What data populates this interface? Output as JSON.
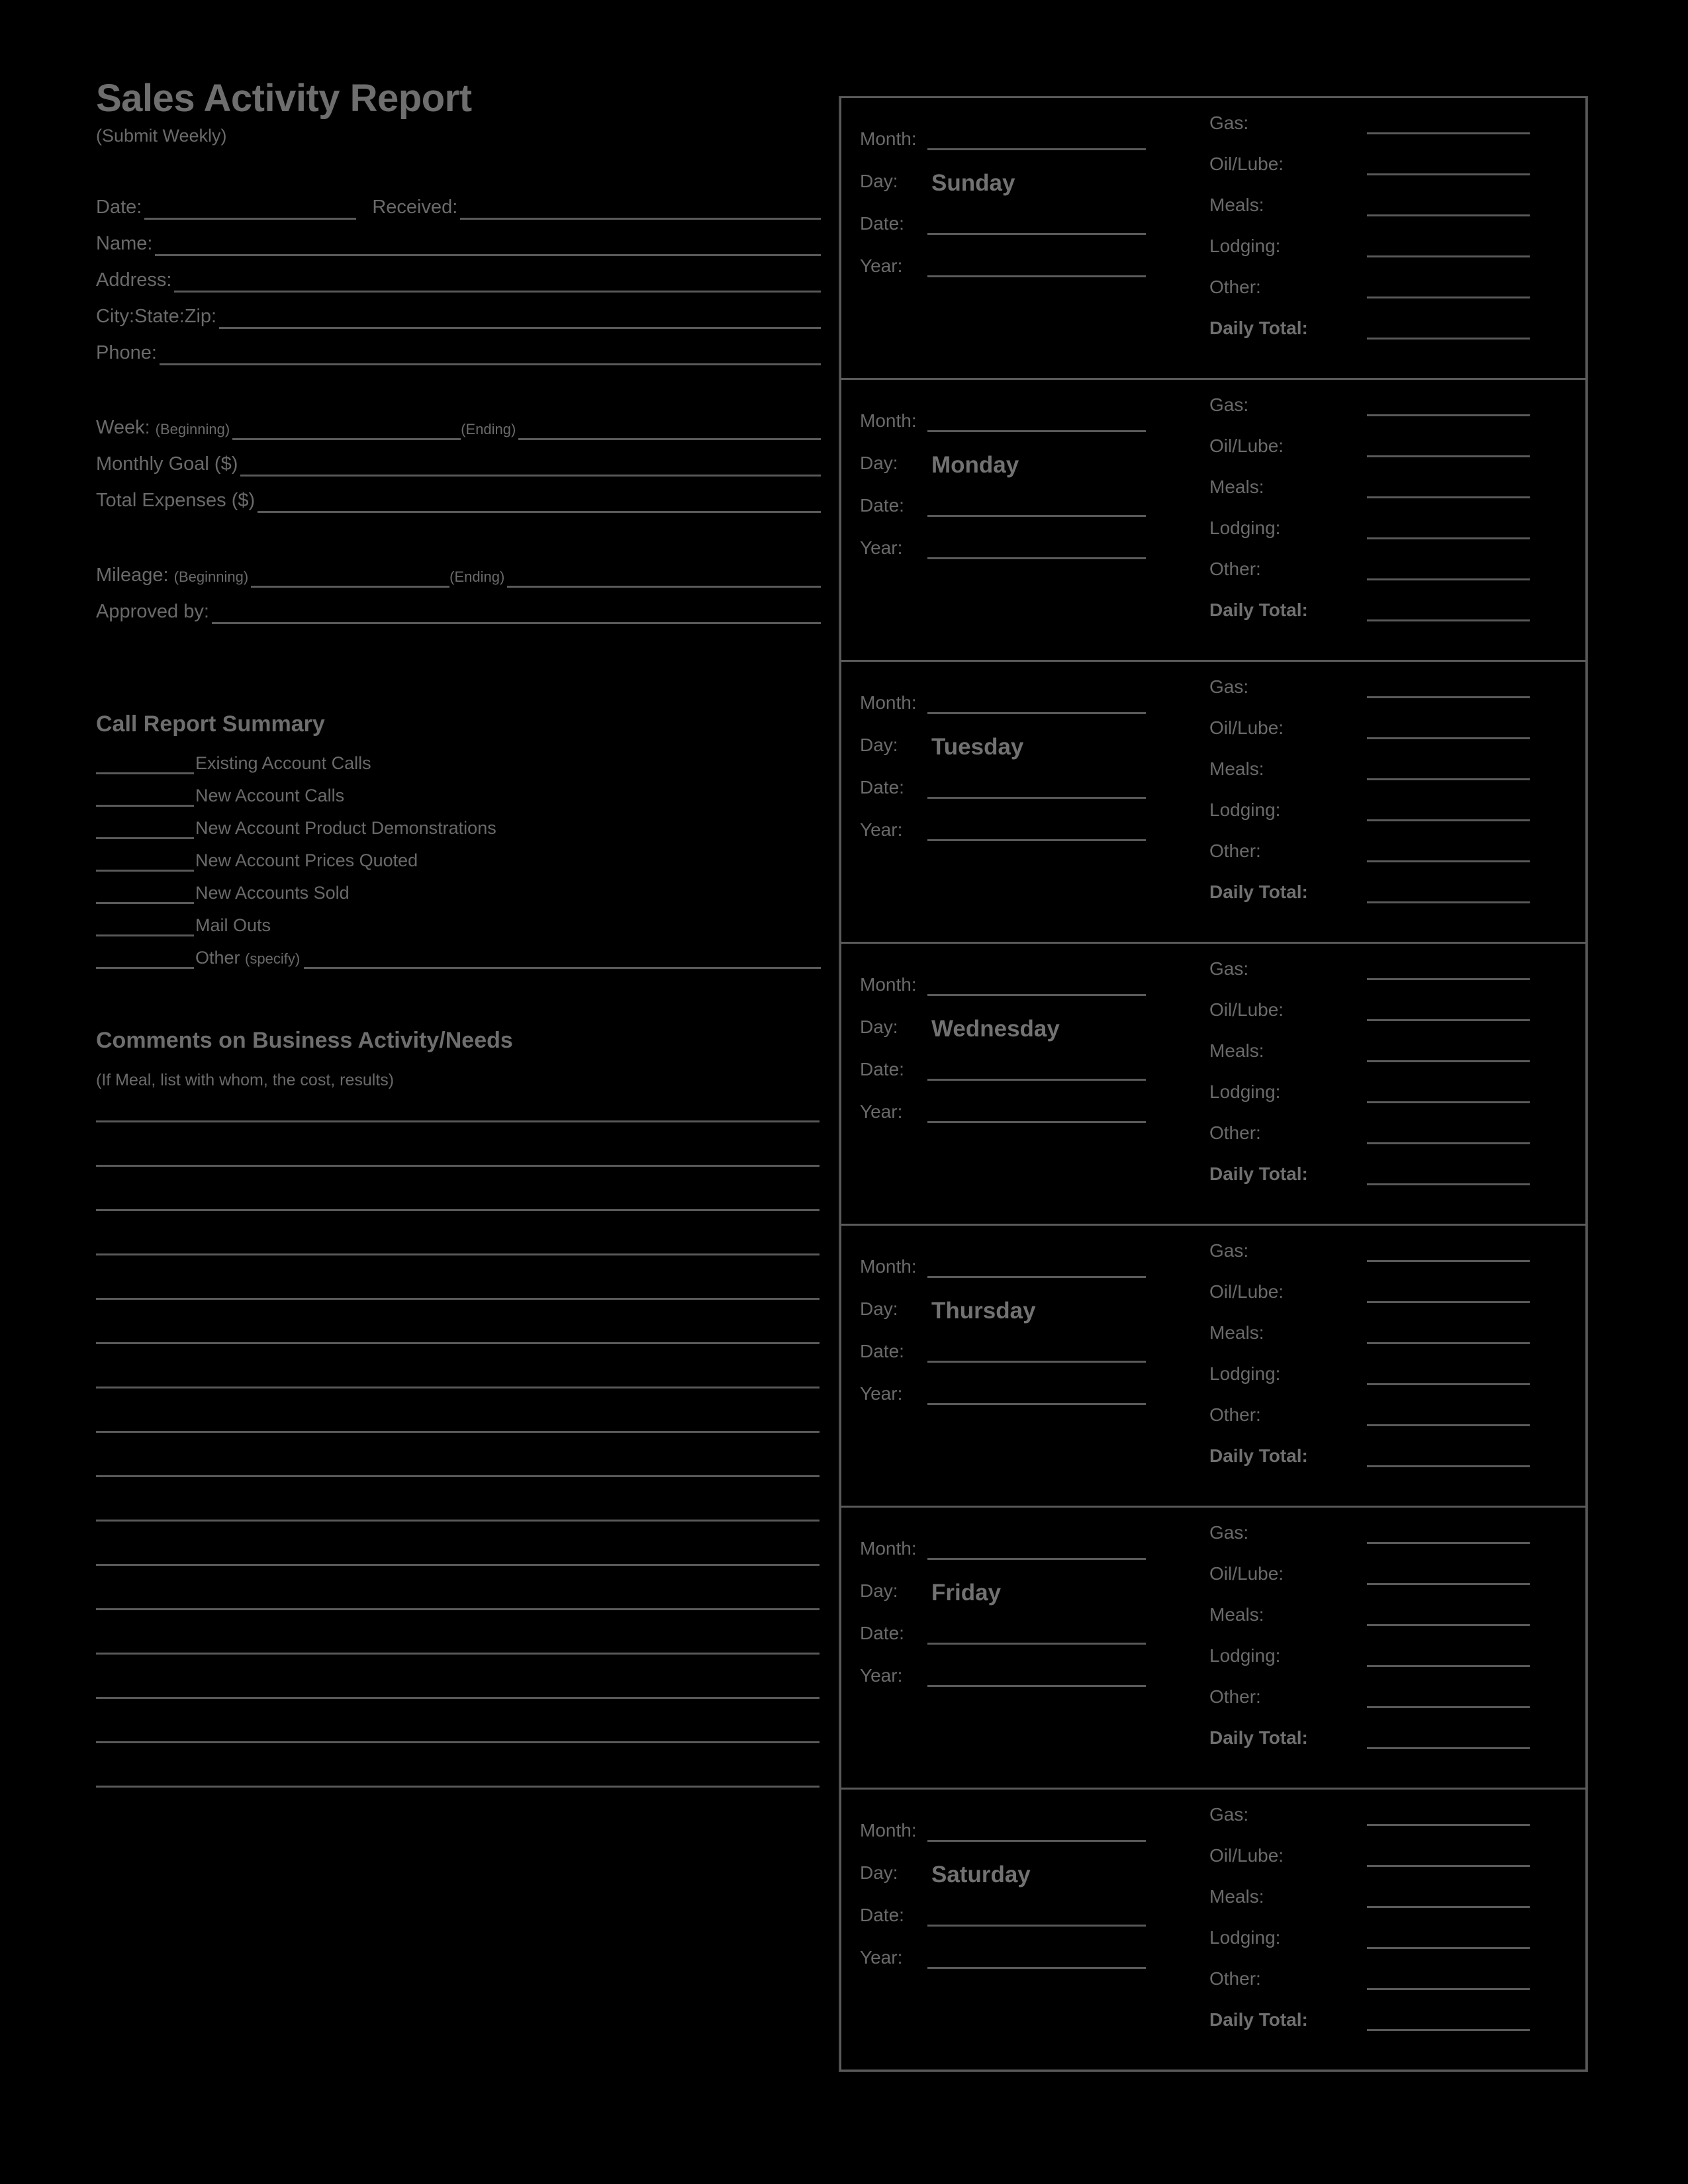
{
  "document": {
    "title": "Sales Activity Report",
    "subtitle": "(Submit Weekly)"
  },
  "header_fields": {
    "date_label": "Date:",
    "received_label": "Received:",
    "name_label": "Name:",
    "address_label": "Address:",
    "city_state_zip_label": "City:State:Zip:",
    "phone_label": "Phone:"
  },
  "week_fields": {
    "week_label": "Week:",
    "week_beginning": "(Beginning)",
    "week_ending": "(Ending)",
    "monthly_goal_label": "Monthly Goal ($)",
    "total_expenses_label": "Total Expenses ($)",
    "mileage_label": "Mileage:",
    "mileage_beginning": "(Beginning)",
    "mileage_ending": "(Ending)",
    "approved_by_label": "Approved by:"
  },
  "call_report": {
    "title": "Call Report Summary",
    "items": [
      {
        "label": "Existing Account Calls",
        "has_tail": false
      },
      {
        "label": "New Account Calls",
        "has_tail": false
      },
      {
        "label": "New Account Product Demonstrations",
        "has_tail": false
      },
      {
        "label": "New Account Prices Quoted",
        "has_tail": false
      },
      {
        "label": "New Accounts Sold",
        "has_tail": false
      },
      {
        "label": "Mail Outs",
        "has_tail": false
      },
      {
        "label": "Other ",
        "suffix": "(specify)",
        "has_tail": true
      }
    ]
  },
  "comments": {
    "title": "Comments on Business Activity/Needs",
    "note": "(If Meal, list with whom, the cost, results)",
    "line_count": 16
  },
  "day_block_labels": {
    "month": "Month:",
    "day": "Day:",
    "date": "Date:",
    "year": "Year:",
    "gas": "Gas:",
    "oil_lube": "Oil/Lube:",
    "meals": "Meals:",
    "lodging": "Lodging:",
    "other": "Other:",
    "daily_total": "Daily Total:"
  },
  "days": [
    {
      "name": "Sunday"
    },
    {
      "name": "Monday"
    },
    {
      "name": "Tuesday"
    },
    {
      "name": "Wednesday"
    },
    {
      "name": "Thursday"
    },
    {
      "name": "Friday"
    },
    {
      "name": "Saturday"
    }
  ],
  "colors": {
    "background": "#000000",
    "text": "#6a6a6a",
    "rule": "#5a5a5a",
    "border": "#4e4e4e"
  }
}
